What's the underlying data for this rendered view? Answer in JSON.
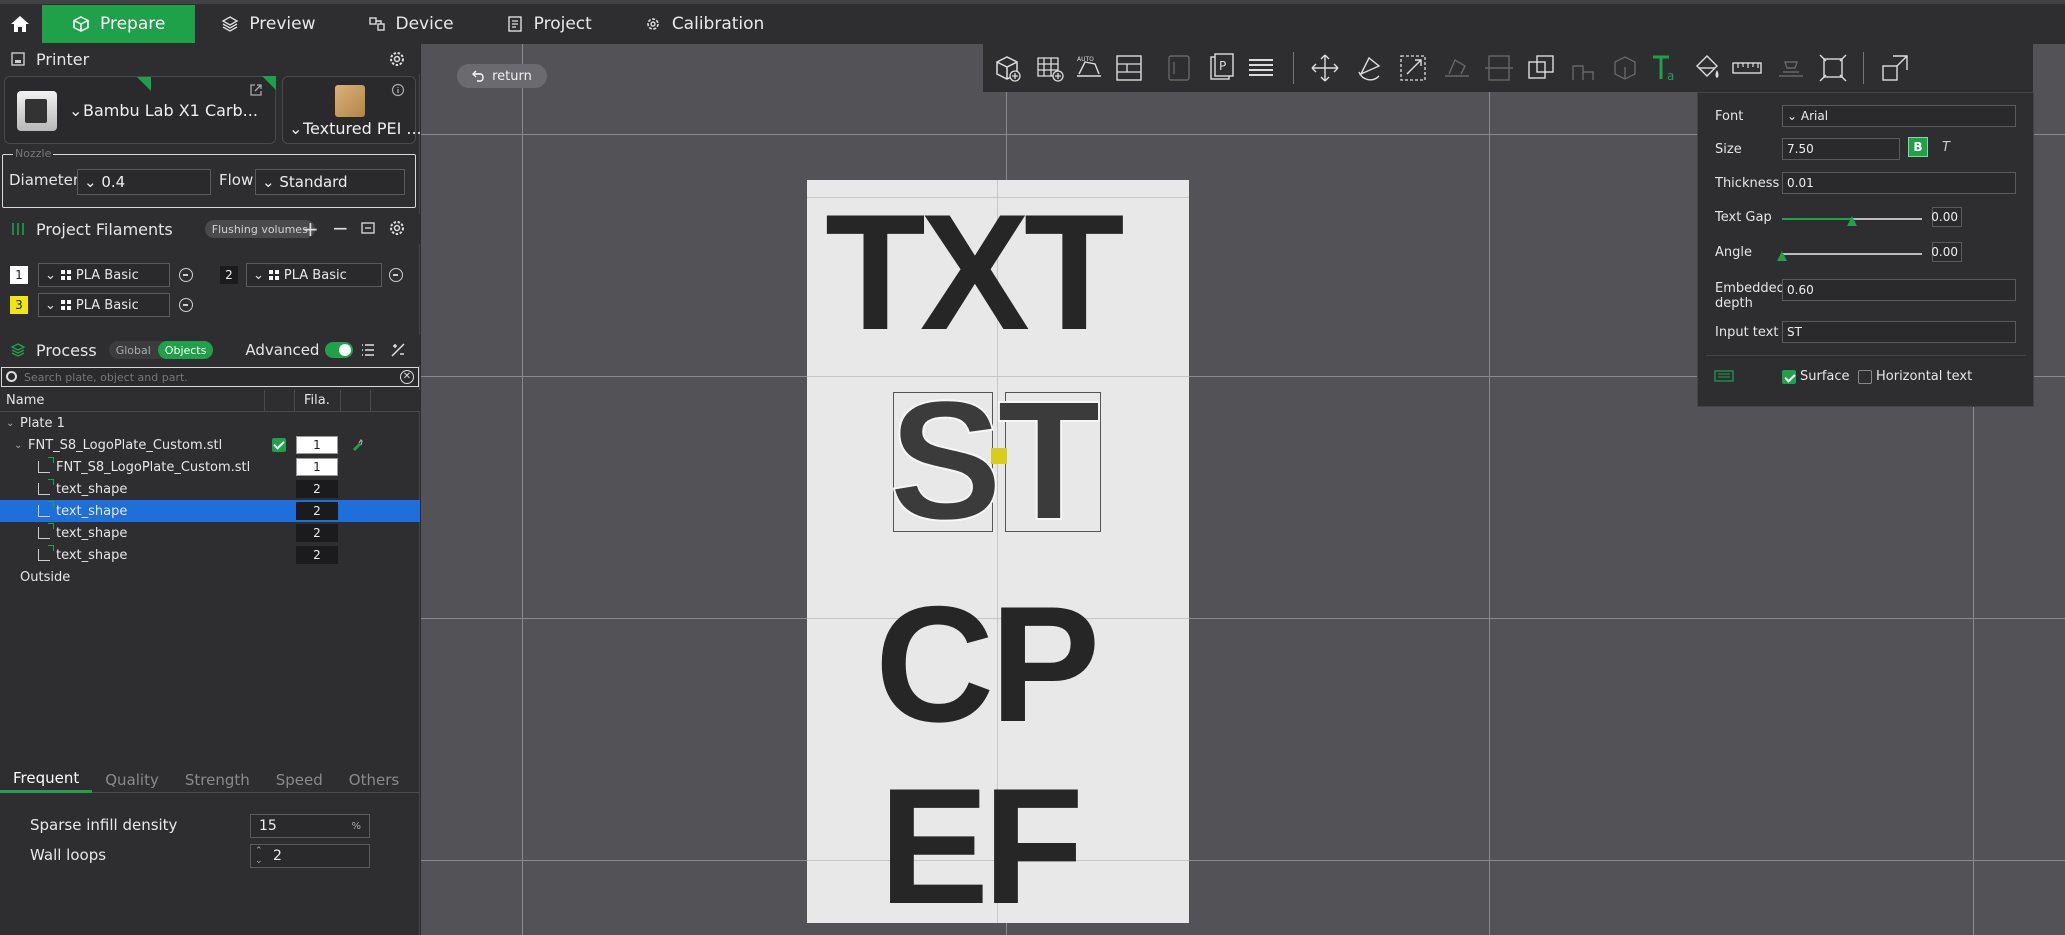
{
  "tabs": [
    {
      "label": "Prepare"
    },
    {
      "label": "Preview"
    },
    {
      "label": "Device"
    },
    {
      "label": "Project"
    },
    {
      "label": "Calibration"
    }
  ],
  "printer": {
    "section_title": "Printer",
    "printer_name": "Bambu Lab X1 Carb...",
    "plate_name": "Textured PEI ...",
    "nozzle_legend": "Nozzle",
    "diameter_label": "Diameter",
    "diameter_value": "0.4",
    "flow_label": "Flow",
    "flow_value": "Standard"
  },
  "filaments": {
    "section_title": "Project Filaments",
    "flushing_label": "Flushing volumes",
    "items": [
      {
        "num": "1",
        "name": "PLA Basic",
        "color": "#ffffff"
      },
      {
        "num": "2",
        "name": "PLA Basic",
        "color": "#1b1b1d"
      },
      {
        "num": "3",
        "name": "PLA Basic",
        "color": "#f2e60f"
      }
    ]
  },
  "process": {
    "section_title": "Process",
    "global_label": "Global",
    "objects_label": "Objects",
    "advanced_label": "Advanced",
    "search_placeholder": "Search plate, object and part.",
    "col_name": "Name",
    "col_fila": "Fila.",
    "tree": [
      {
        "label": "Plate 1"
      },
      {
        "label": "FNT_S8_LogoPlate_Custom.stl",
        "fila": "1"
      },
      {
        "label": "FNT_S8_LogoPlate_Custom.stl",
        "fila": "1"
      },
      {
        "label": "text_shape",
        "fila": "2"
      },
      {
        "label": "text_shape",
        "fila": "2"
      },
      {
        "label": "text_shape",
        "fila": "2"
      },
      {
        "label": "text_shape",
        "fila": "2"
      },
      {
        "label": "Outside"
      }
    ]
  },
  "param_tabs": [
    "Frequent",
    "Quality",
    "Strength",
    "Speed",
    "Others"
  ],
  "params": {
    "sparse_label": "Sparse infill density",
    "sparse_value": "15",
    "sparse_unit": "%",
    "wall_label": "Wall loops",
    "wall_value": "2"
  },
  "canvas": {
    "return_label": "return",
    "letters": {
      "row1": "TXT",
      "row2_a": "S",
      "row2_b": "T",
      "row3": "CP",
      "row4": "EF"
    }
  },
  "text_panel": {
    "font_label": "Font",
    "font_value": "Arial",
    "size_label": "Size",
    "size_value": "7.50",
    "bold_label": "B",
    "italic_label": "T",
    "thickness_label": "Thickness",
    "thickness_value": "0.01",
    "gap_label": "Text Gap",
    "gap_value": "0.00",
    "gap_fraction": 0.5,
    "angle_label": "Angle",
    "angle_value": "0.00",
    "angle_fraction": 0.0,
    "embed_label_1": "Embedded",
    "embed_label_2": "depth",
    "embed_value": "0.60",
    "input_label": "Input text",
    "input_value": "ST",
    "surface_label": "Surface",
    "surface_checked": true,
    "horizontal_label": "Horizontal text",
    "horizontal_checked": false
  },
  "colors": {
    "accent": "#1fa14a",
    "selection": "#1e6fd9"
  }
}
